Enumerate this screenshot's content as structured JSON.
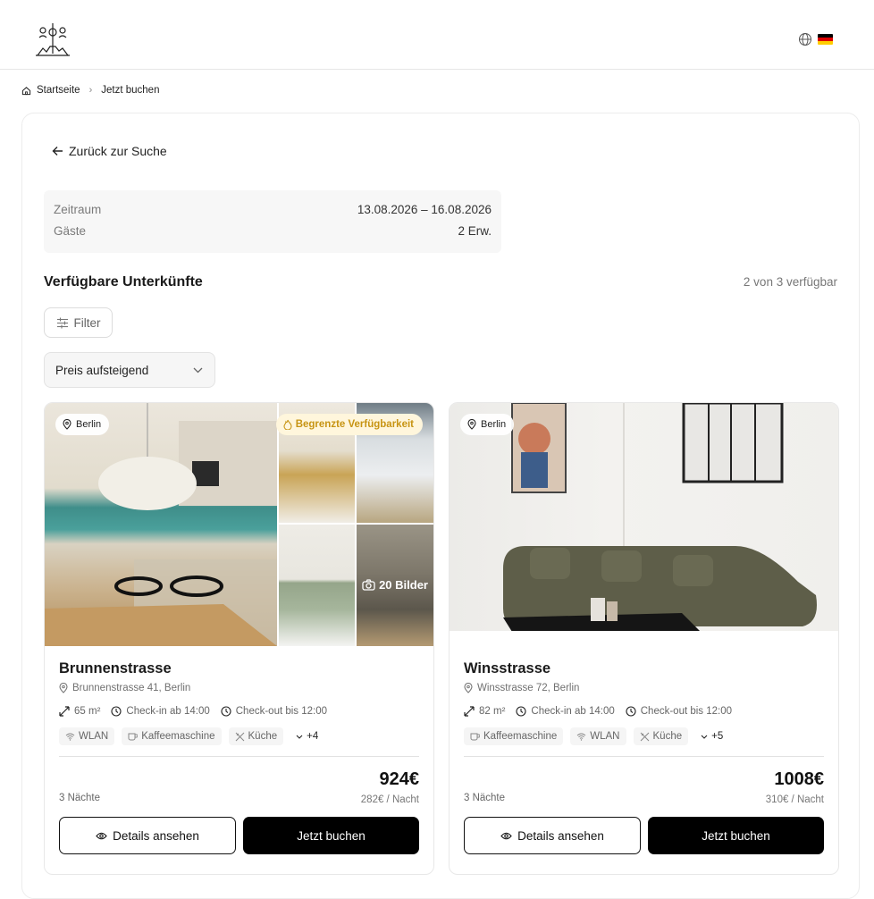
{
  "header": {
    "logo_icon": "tv-tower-logo-icon",
    "language_icon": "globe-icon",
    "flag_icon": "german-flag-icon",
    "flag_colors": [
      "#000000",
      "#dd0000",
      "#ffce00"
    ]
  },
  "breadcrumb": {
    "home": "Startseite",
    "current": "Jetzt buchen"
  },
  "back_label": "Zurück zur Suche",
  "summary": {
    "period_label": "Zeitraum",
    "period_value": "13.08.2026 – 16.08.2026",
    "guests_label": "Gäste",
    "guests_value": "2 Erw."
  },
  "listing": {
    "title": "Verfügbare Unterkünfte",
    "availability": "2 von 3 verfügbar",
    "filter_label": "Filter",
    "sort_value": "Preis aufsteigend"
  },
  "cards": [
    {
      "location": "Berlin",
      "badge": "Begrenzte Verfügbarkeit",
      "photos": "20 Bilder",
      "name": "Brunnenstrasse",
      "address": "Brunnenstrasse 41, Berlin",
      "size": "65 m²",
      "checkin": "Check-in ab 14:00",
      "checkout": "Check-out bis 12:00",
      "amenities": [
        "WLAN",
        "Kaffeemaschine",
        "Küche"
      ],
      "more": "+4",
      "nights": "3 Nächte",
      "price": "924€",
      "per_night": "282€ / Nacht",
      "details_label": "Details ansehen",
      "book_label": "Jetzt buchen"
    },
    {
      "location": "Berlin",
      "name": "Winsstrasse",
      "address": "Winsstrasse 72, Berlin",
      "size": "82 m²",
      "checkin": "Check-in ab 14:00",
      "checkout": "Check-out bis 12:00",
      "amenities": [
        "Kaffeemaschine",
        "WLAN",
        "Küche"
      ],
      "more": "+5",
      "nights": "3 Nächte",
      "price": "1008€",
      "per_night": "310€ / Nacht",
      "details_label": "Details ansehen",
      "book_label": "Jetzt buchen"
    }
  ],
  "colors": {
    "accent": "#000000",
    "badge_text": "#c79413",
    "badge_bg": "#fff6dc"
  }
}
